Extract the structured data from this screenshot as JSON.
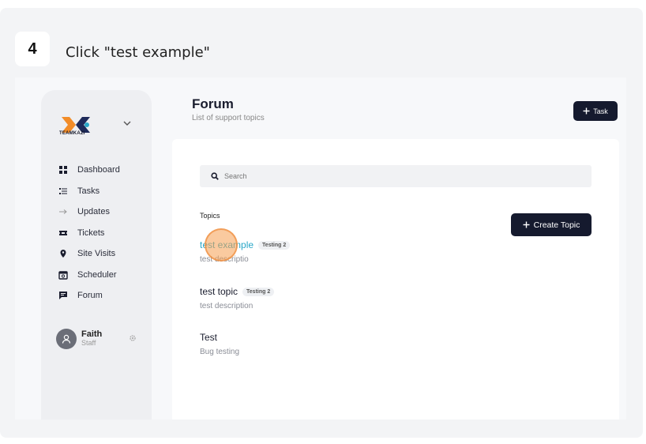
{
  "step": {
    "number": "4",
    "instruction": "Click \"test example\""
  },
  "logo": {
    "text": "TEAMKAZI"
  },
  "sidebar": {
    "items": [
      {
        "label": "Dashboard",
        "icon": "dashboard-icon"
      },
      {
        "label": "Tasks",
        "icon": "tasks-icon"
      },
      {
        "label": "Updates",
        "icon": "arrow-right-icon"
      },
      {
        "label": "Tickets",
        "icon": "ticket-icon"
      },
      {
        "label": "Site Visits",
        "icon": "location-pin-icon"
      },
      {
        "label": "Scheduler",
        "icon": "calendar-icon"
      },
      {
        "label": "Forum",
        "icon": "chat-icon"
      }
    ],
    "user": {
      "name": "Faith",
      "role": "Staff"
    }
  },
  "header": {
    "title": "Forum",
    "subtitle": "List of support topics",
    "task_button": "Task"
  },
  "search": {
    "placeholder": "Search"
  },
  "topics": {
    "heading": "Topics",
    "create_button": "Create Topic",
    "items": [
      {
        "title": "test example",
        "badge": "Testing 2",
        "description": "test descriptio"
      },
      {
        "title": "test topic",
        "badge": "Testing 2",
        "description": "test description"
      },
      {
        "title": "Test",
        "badge": "",
        "description": "Bug testing"
      }
    ]
  },
  "colors": {
    "accent_dark": "#151a2e",
    "link": "#2aa7c8",
    "logo_orange": "#f28c28",
    "logo_navy": "#1e2a5a",
    "click_marker": "#f59e50"
  }
}
